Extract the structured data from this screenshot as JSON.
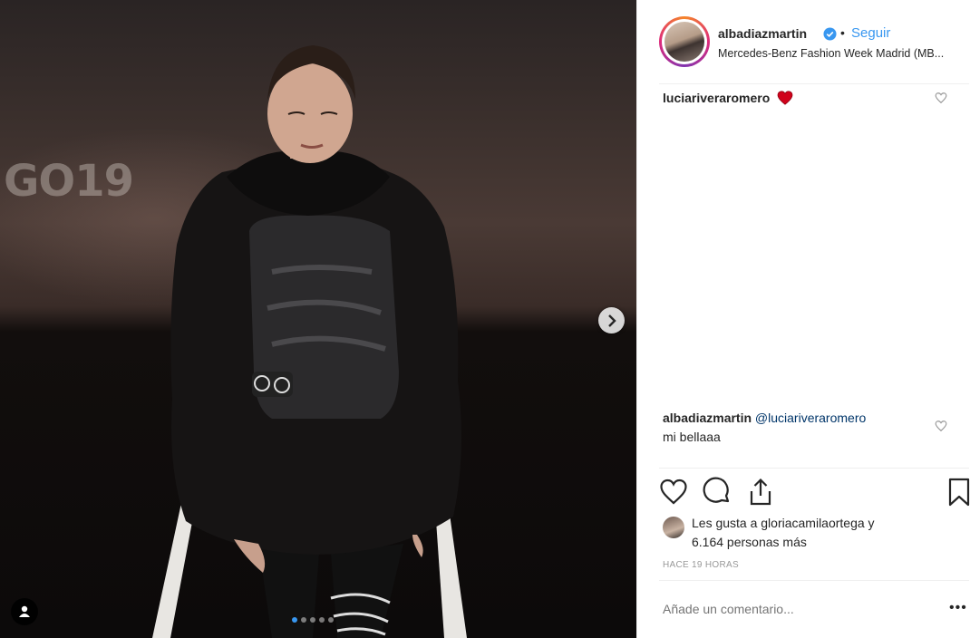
{
  "post": {
    "username": "albadiazmartin",
    "separator": "•",
    "follow_label": "Seguir",
    "location": "Mercedes-Benz Fashion Week Madrid (MB...",
    "photo_overlay_text": "GO19",
    "carousel": {
      "count": 5,
      "active_index": 0
    }
  },
  "comments": [
    {
      "user": "luciariveraromero",
      "text": "",
      "emoji": "red-heart"
    },
    {
      "user": "albadiazmartin",
      "mention": "@luciariveraromero",
      "text": "mi bellaaa"
    }
  ],
  "likes": {
    "line1": "Les gusta a gloriacamilaortega y",
    "line2": "6.164 personas más"
  },
  "timestamp": "HACE 19 HORAS",
  "add_comment": {
    "placeholder": "Añade un comentario..."
  },
  "more_label": "•••",
  "colors": {
    "link": "#3897f0",
    "mention": "#003569",
    "text": "#262626",
    "muted": "#999999",
    "heart": "#ed4956"
  }
}
